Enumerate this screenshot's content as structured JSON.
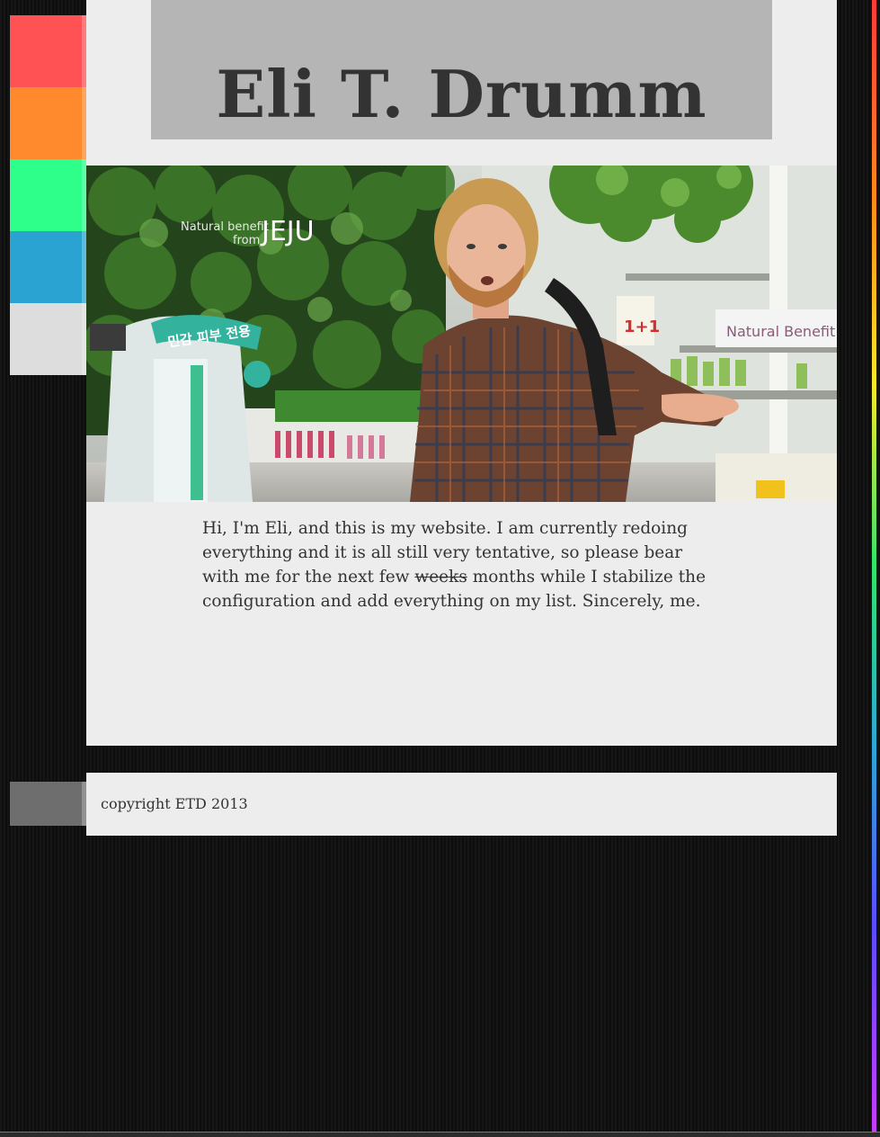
{
  "header": {
    "title": "Eli T. Drumm"
  },
  "nav": {
    "tabs": [
      {
        "name": "red",
        "color": "#ff5254"
      },
      {
        "name": "orange",
        "color": "#ff8a2d"
      },
      {
        "name": "green",
        "color": "#2dff8a"
      },
      {
        "name": "blue",
        "color": "#2aa3d3"
      },
      {
        "name": "light",
        "color": "#dddddd"
      }
    ],
    "footer_tab_color": "#6e6e6e"
  },
  "intro": {
    "text_before": "Hi, I'm Eli, and this is my website. I am currently redoing everything and it is all still very tentative, so please bear with me for the next few ",
    "struck_word": "weeks",
    "text_after": " months while I stabilize the configuration and add everything on my list. Sincerely, me."
  },
  "photo": {
    "signs": {
      "jeju_small": "Natural benefit",
      "jeju_from": "from",
      "jeju_brand": "JEJU",
      "korean": "민감 피부 전용",
      "natural_benefit": "Natural Benefit",
      "promo": "1+1"
    }
  },
  "footer": {
    "copyright": "copyright ETD 2013"
  },
  "colors": {
    "background": "#121212",
    "panel": "#ededed",
    "title_box": "#b5b5b5",
    "text": "#333333"
  }
}
